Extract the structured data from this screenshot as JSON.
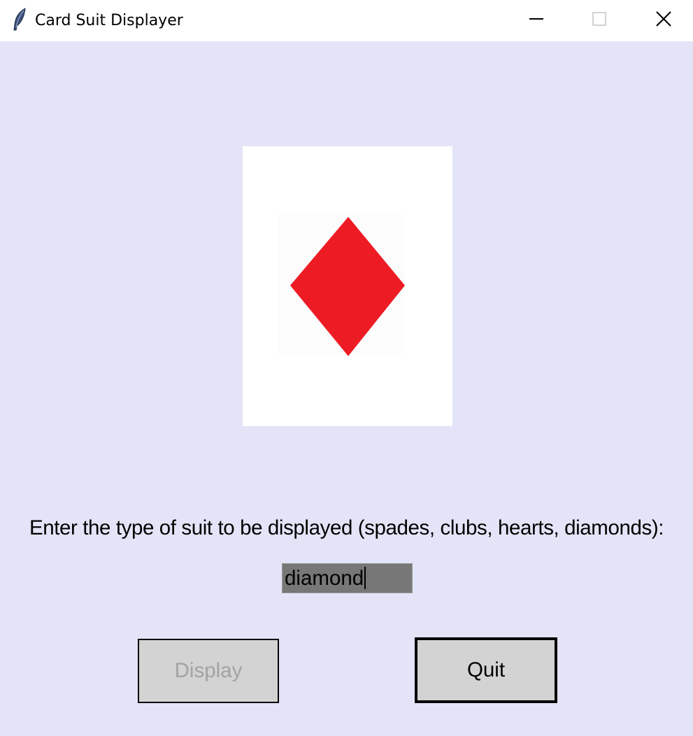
{
  "window": {
    "title": "Card Suit Displayer",
    "app_icon": "feather-icon",
    "controls": [
      "minimize-icon",
      "maximize-icon",
      "close-icon"
    ]
  },
  "card": {
    "suit": "diamond-icon",
    "suit_color": "#ed1c24",
    "background": "#ffffff"
  },
  "prompt": {
    "label": "Enter the type of suit to be displayed (spades, clubs, hearts, diamonds):"
  },
  "entry": {
    "value": "diamond"
  },
  "buttons": {
    "display_label": "Display",
    "display_state": "disabled",
    "quit_label": "Quit"
  },
  "colors": {
    "window_background": "#e4e4f8",
    "button_background": "#d3d3d3",
    "entry_background": "#777777",
    "disabled_text": "#a3a3a3"
  }
}
